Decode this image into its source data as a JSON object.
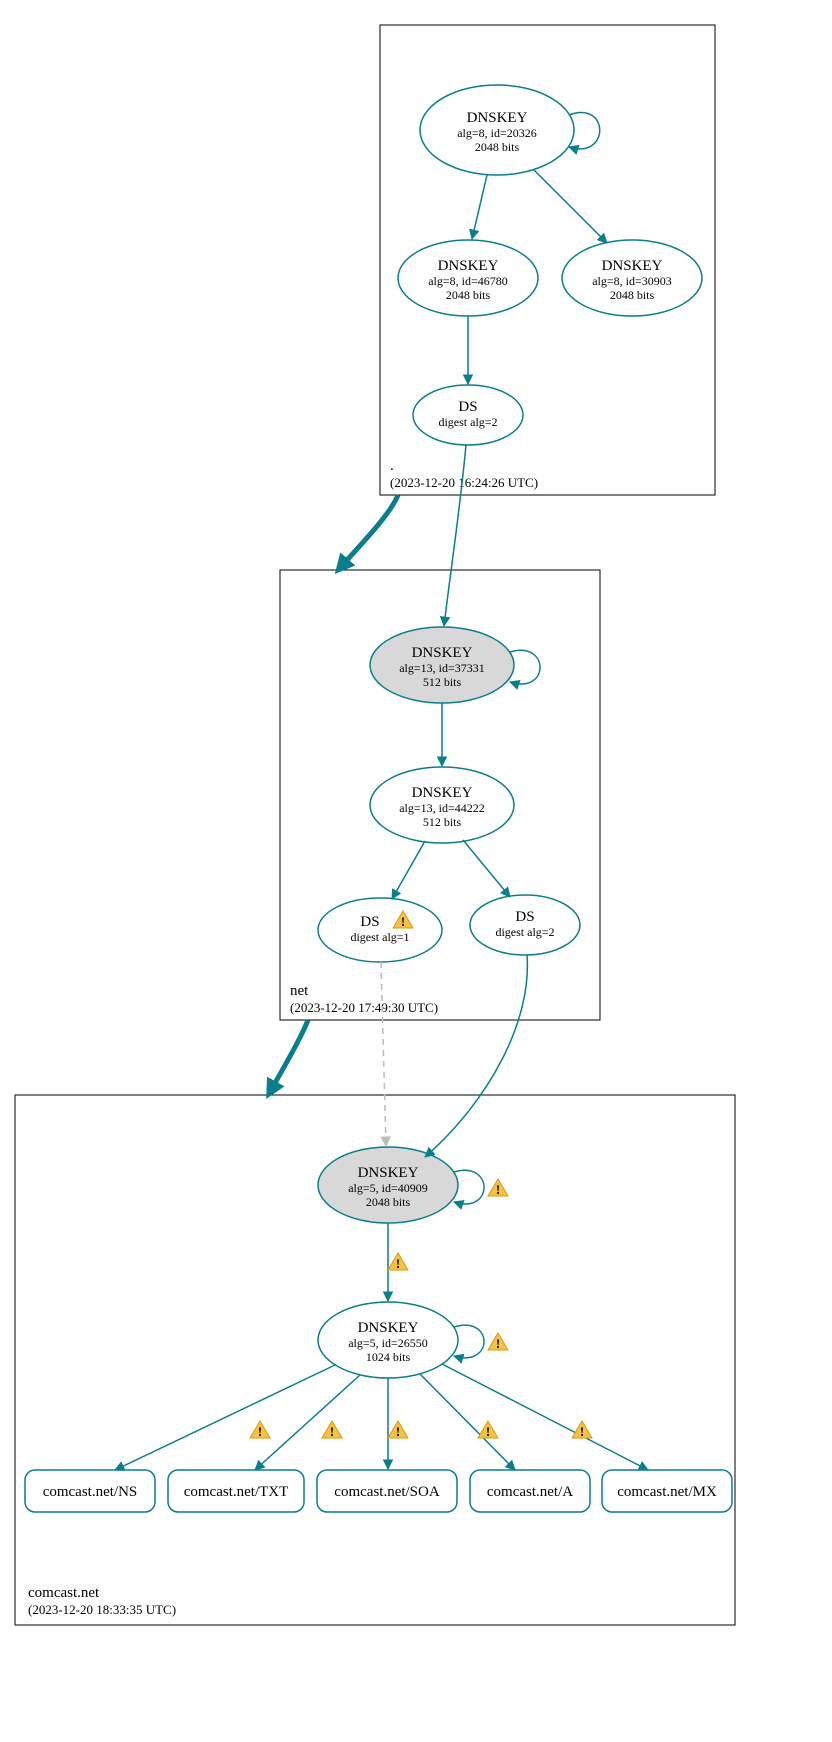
{
  "colors": {
    "accent": "#0a7e8c",
    "node_fill_grey": "#d8d8d8",
    "warning": "#f6c244"
  },
  "zones": [
    {
      "id": "root",
      "label": ".",
      "timestamp": "(2023-12-20 16:24:26 UTC)"
    },
    {
      "id": "net",
      "label": "net",
      "timestamp": "(2023-12-20 17:49:30 UTC)"
    },
    {
      "id": "comcast",
      "label": "comcast.net",
      "timestamp": "(2023-12-20 18:33:35 UTC)"
    }
  ],
  "nodes": {
    "root_ksk": {
      "title": "DNSKEY",
      "line2": "alg=8, id=20326",
      "line3": "2048 bits"
    },
    "root_zsk1": {
      "title": "DNSKEY",
      "line2": "alg=8, id=46780",
      "line3": "2048 bits"
    },
    "root_zsk2": {
      "title": "DNSKEY",
      "line2": "alg=8, id=30903",
      "line3": "2048 bits"
    },
    "root_ds": {
      "title": "DS",
      "line2": "digest alg=2"
    },
    "net_ksk": {
      "title": "DNSKEY",
      "line2": "alg=13, id=37331",
      "line3": "512 bits"
    },
    "net_zsk": {
      "title": "DNSKEY",
      "line2": "alg=13, id=44222",
      "line3": "512 bits"
    },
    "net_ds1": {
      "title": "DS",
      "line2": "digest alg=1",
      "warning": true
    },
    "net_ds2": {
      "title": "DS",
      "line2": "digest alg=2"
    },
    "com_ksk": {
      "title": "DNSKEY",
      "line2": "alg=5, id=40909",
      "line3": "2048 bits"
    },
    "com_zsk": {
      "title": "DNSKEY",
      "line2": "alg=5, id=26550",
      "line3": "1024 bits"
    }
  },
  "rrsets": {
    "ns": {
      "label": "comcast.net/NS"
    },
    "txt": {
      "label": "comcast.net/TXT"
    },
    "soa": {
      "label": "comcast.net/SOA"
    },
    "a": {
      "label": "comcast.net/A"
    },
    "mx": {
      "label": "comcast.net/MX"
    }
  },
  "warnings": {
    "net_ds1": true,
    "com_ksk_self": true,
    "com_ksk_to_zsk": true,
    "com_zsk_self": true,
    "com_zsk_to_ns": true,
    "com_zsk_to_txt": true,
    "com_zsk_to_soa": true,
    "com_zsk_to_a": true,
    "com_zsk_to_mx": true
  }
}
